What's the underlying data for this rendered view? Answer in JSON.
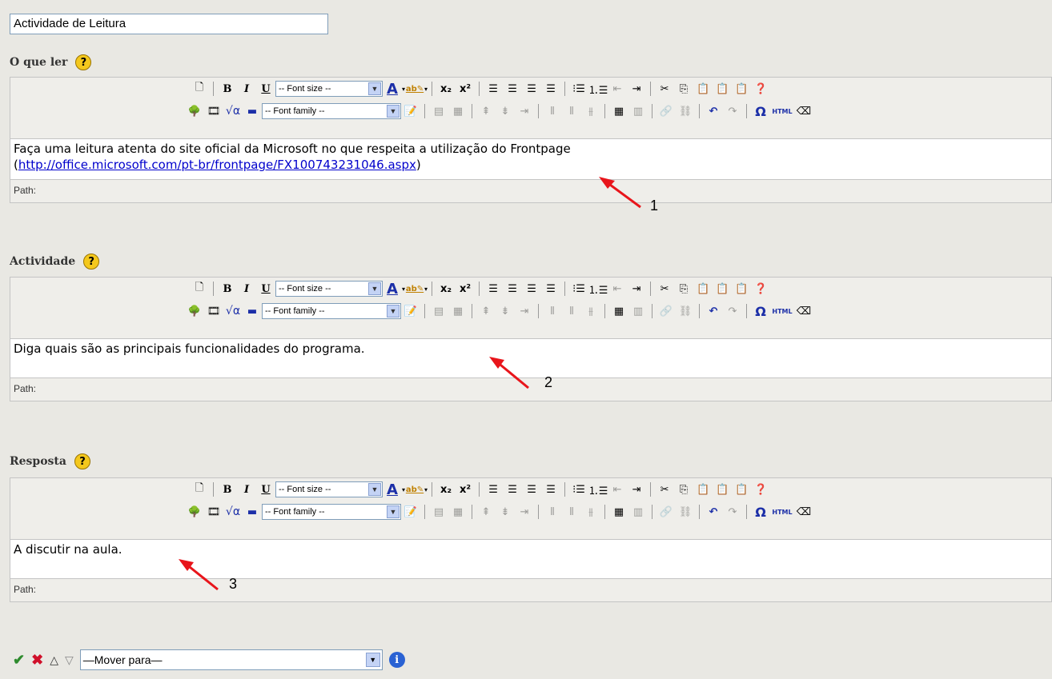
{
  "title_input": {
    "value": "Actividade de Leitura"
  },
  "sections": [
    {
      "label": "O que ler",
      "content_line1": "Faça uma leitura atenta do site oficial da Microsoft no que respeita a utilização do Frontpage",
      "content_link": "http://office.microsoft.com/pt-br/frontpage/FX100743231046.aspx",
      "path_label": "Path:",
      "annotation": "1"
    },
    {
      "label": "Actividade",
      "content_line1": "Diga quais são as principais funcionalidades do programa.",
      "path_label": "Path:",
      "annotation": "2"
    },
    {
      "label": "Resposta",
      "content_line1": "A discutir na aula.",
      "path_label": "Path:",
      "annotation": "3"
    }
  ],
  "help_icon_text": "?",
  "toolbar": {
    "font_size_placeholder": "-- Font size --",
    "font_family_placeholder": "-- Font family --",
    "bold": "B",
    "italic": "I",
    "underline": "U",
    "html_label": "HTML"
  },
  "bottom": {
    "mover_placeholder": "—Mover para—"
  },
  "colors": {
    "annotation_arrow": "#e8151b",
    "background": "#e9e8e3",
    "link": "#0000cc"
  }
}
